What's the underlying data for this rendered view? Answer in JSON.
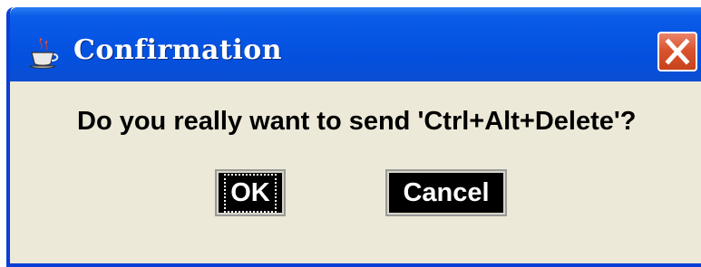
{
  "dialog": {
    "title": "Confirmation",
    "title_icon": "java-coffee-cup-icon",
    "close_icon": "close-x-icon",
    "message": "Do you really want to send 'Ctrl+Alt+Delete'?",
    "buttons": {
      "ok_label": "OK",
      "cancel_label": "Cancel"
    }
  },
  "colors": {
    "titlebar": "#0654e3",
    "client_bg": "#ece9d8",
    "close_button": "#d9542e",
    "button_bg": "#000000",
    "button_text": "#ffffff"
  }
}
